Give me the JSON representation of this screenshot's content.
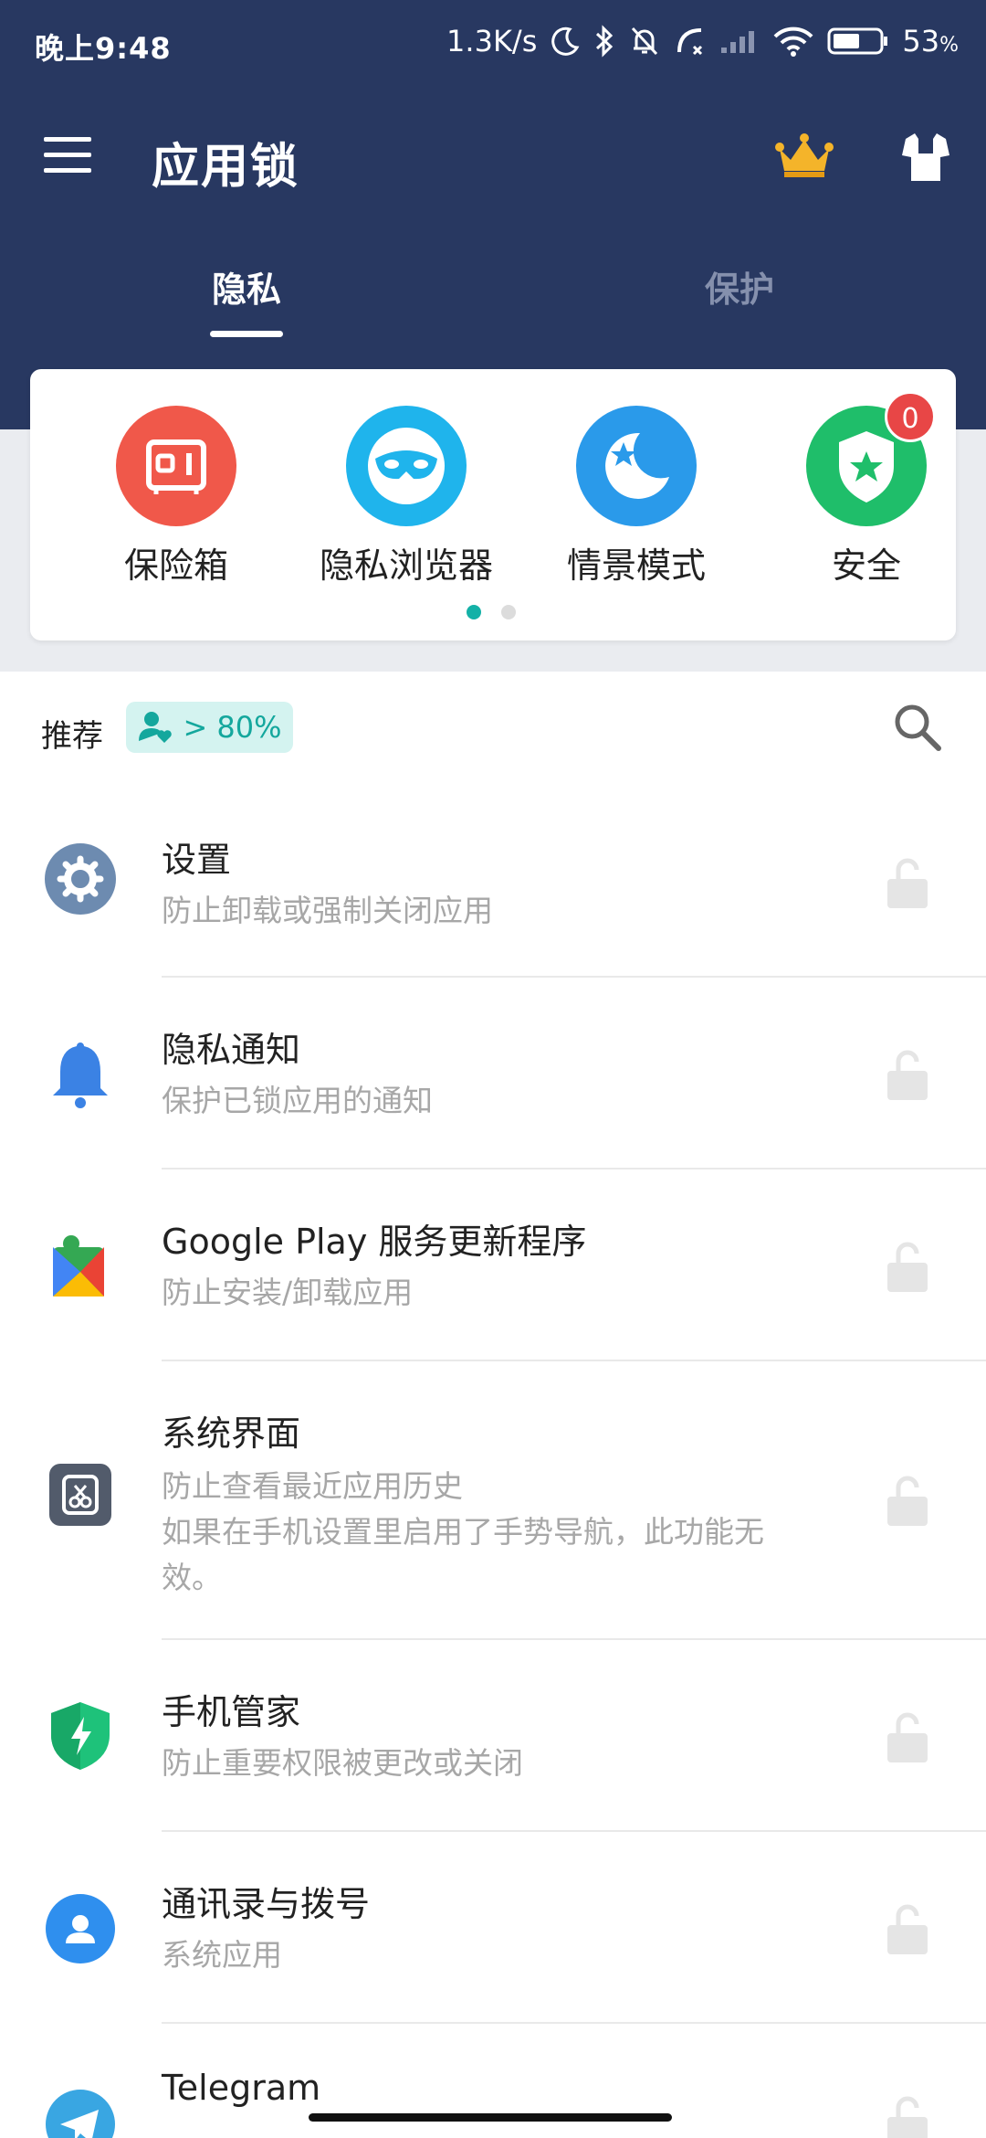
{
  "status_bar": {
    "time": "晚上9:48",
    "speed": "1.3K/s",
    "battery": "53",
    "battery_unit": "%"
  },
  "toolbar": {
    "title": "应用锁"
  },
  "tabs": [
    {
      "label": "隐私",
      "active": true
    },
    {
      "label": "保护",
      "active": false
    }
  ],
  "features": [
    {
      "label": "保险箱",
      "icon": "safe-icon",
      "color": "#f0584a"
    },
    {
      "label": "隐私浏览器",
      "icon": "mask-icon",
      "color": "#1fb4ec"
    },
    {
      "label": "情景模式",
      "icon": "moon-star-icon",
      "color": "#2a9aea"
    },
    {
      "label": "安全",
      "icon": "shield-star-icon",
      "color": "#1fbe6a",
      "badge": "0"
    }
  ],
  "carousel": {
    "pages": 2,
    "active": 0
  },
  "recommend": {
    "label": "推荐",
    "badge": "> 80%"
  },
  "apps": [
    {
      "title": "设置",
      "sub": "防止卸载或强制关闭应用",
      "icon": "settings-gear-icon"
    },
    {
      "title": "隐私通知",
      "sub": "保护已锁应用的通知",
      "icon": "bell-icon"
    },
    {
      "title": "Google Play 服务更新程序",
      "sub": "防止安装/卸载应用",
      "icon": "google-play-puzzle-icon"
    },
    {
      "title": "系统界面",
      "sub": "防止查看最近应用历史",
      "sub2": "如果在手机设置里启用了手势导航，此功能无",
      "sub3": "效。",
      "icon": "system-ui-icon"
    },
    {
      "title": "手机管家",
      "sub": "防止重要权限被更改或关闭",
      "icon": "security-shield-icon"
    },
    {
      "title": "通讯录与拨号",
      "sub": "系统应用",
      "icon": "contacts-icon"
    },
    {
      "title": "Telegram",
      "sub": "",
      "icon": "telegram-icon"
    }
  ],
  "colors": {
    "header": "#283861",
    "accent": "#14b1a7",
    "badge": "#e84646"
  }
}
